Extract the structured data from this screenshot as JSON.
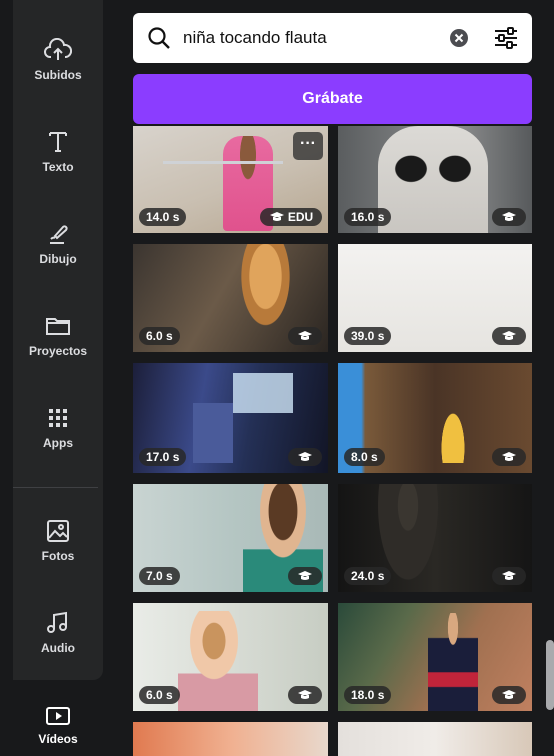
{
  "sidebar": {
    "items": [
      {
        "label": "Subidos",
        "icon": "cloud-upload-icon"
      },
      {
        "label": "Texto",
        "icon": "text-icon"
      },
      {
        "label": "Dibujo",
        "icon": "draw-icon"
      },
      {
        "label": "Proyectos",
        "icon": "folder-icon"
      },
      {
        "label": "Apps",
        "icon": "apps-grid-icon"
      },
      {
        "label": "Fotos",
        "icon": "photo-icon"
      },
      {
        "label": "Audio",
        "icon": "music-note-icon"
      },
      {
        "label": "Vídeos",
        "icon": "video-icon"
      }
    ]
  },
  "search": {
    "value": "niña tocando flauta",
    "icon": "search-icon",
    "clear_icon": "clear-icon",
    "filter_icon": "filter-sliders-icon"
  },
  "record_button": {
    "label": "Grábate",
    "color": "#8b3dff"
  },
  "videos": [
    {
      "duration": "14.0 s",
      "badge": "EDU",
      "has_more": true
    },
    {
      "duration": "16.0 s",
      "badge": ""
    },
    {
      "duration": "6.0 s",
      "badge": ""
    },
    {
      "duration": "39.0 s",
      "badge": ""
    },
    {
      "duration": "17.0 s",
      "badge": ""
    },
    {
      "duration": "8.0 s",
      "badge": ""
    },
    {
      "duration": "7.0 s",
      "badge": ""
    },
    {
      "duration": "24.0 s",
      "badge": ""
    },
    {
      "duration": "6.0 s",
      "badge": ""
    },
    {
      "duration": "18.0 s",
      "badge": ""
    }
  ],
  "more_label": "···"
}
